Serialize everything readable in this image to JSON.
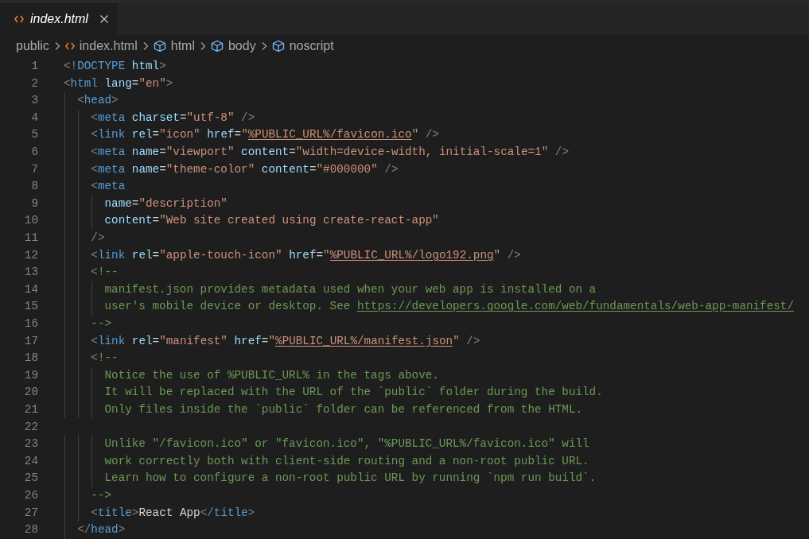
{
  "tabs": [
    {
      "label": "index.html",
      "selected": true
    }
  ],
  "breadcrumbs": [
    {
      "label": "public",
      "kind": "folder"
    },
    {
      "label": "index.html",
      "kind": "file"
    },
    {
      "label": "html",
      "kind": "element"
    },
    {
      "label": "body",
      "kind": "element"
    },
    {
      "label": "noscript",
      "kind": "element"
    }
  ],
  "lines": [
    {
      "number": "1",
      "tokens": [
        {
          "kind": "punct",
          "text": "<!"
        },
        {
          "kind": "tag",
          "text": "DOCTYPE"
        },
        {
          "kind": "attr",
          "text": " html"
        },
        {
          "kind": "punct",
          "text": ">"
        }
      ]
    },
    {
      "number": "2",
      "tokens": [
        {
          "kind": "punct",
          "text": "<"
        },
        {
          "kind": "tag",
          "text": "html"
        },
        {
          "kind": "attr",
          "text": " lang"
        },
        {
          "kind": "text",
          "text": "="
        },
        {
          "kind": "str",
          "text": "\"en\""
        },
        {
          "kind": "punct",
          "text": ">"
        }
      ]
    },
    {
      "number": "3",
      "tokens": [
        {
          "kind": "punct",
          "text": "  <"
        },
        {
          "kind": "tag",
          "text": "head"
        },
        {
          "kind": "punct",
          "text": ">"
        }
      ]
    },
    {
      "number": "4",
      "tokens": [
        {
          "kind": "punct",
          "text": "    <"
        },
        {
          "kind": "tag",
          "text": "meta"
        },
        {
          "kind": "attr",
          "text": " charset"
        },
        {
          "kind": "text",
          "text": "="
        },
        {
          "kind": "str",
          "text": "\"utf-8\""
        },
        {
          "kind": "punct",
          "text": " />"
        }
      ]
    },
    {
      "number": "5",
      "tokens": [
        {
          "kind": "punct",
          "text": "    <"
        },
        {
          "kind": "tag",
          "text": "link"
        },
        {
          "kind": "attr",
          "text": " rel"
        },
        {
          "kind": "text",
          "text": "="
        },
        {
          "kind": "str",
          "text": "\"icon\""
        },
        {
          "kind": "attr",
          "text": " href"
        },
        {
          "kind": "text",
          "text": "="
        },
        {
          "kind": "str",
          "text": "\""
        },
        {
          "kind": "strlink",
          "text": "%PUBLIC_URL%/favicon.ico"
        },
        {
          "kind": "str",
          "text": "\""
        },
        {
          "kind": "punct",
          "text": " />"
        }
      ]
    },
    {
      "number": "6",
      "tokens": [
        {
          "kind": "punct",
          "text": "    <"
        },
        {
          "kind": "tag",
          "text": "meta"
        },
        {
          "kind": "attr",
          "text": " name"
        },
        {
          "kind": "text",
          "text": "="
        },
        {
          "kind": "str",
          "text": "\"viewport\""
        },
        {
          "kind": "attr",
          "text": " content"
        },
        {
          "kind": "text",
          "text": "="
        },
        {
          "kind": "str",
          "text": "\"width=device-width, initial-scale=1\""
        },
        {
          "kind": "punct",
          "text": " />"
        }
      ]
    },
    {
      "number": "7",
      "tokens": [
        {
          "kind": "punct",
          "text": "    <"
        },
        {
          "kind": "tag",
          "text": "meta"
        },
        {
          "kind": "attr",
          "text": " name"
        },
        {
          "kind": "text",
          "text": "="
        },
        {
          "kind": "str",
          "text": "\"theme-color\""
        },
        {
          "kind": "attr",
          "text": " content"
        },
        {
          "kind": "text",
          "text": "="
        },
        {
          "kind": "str",
          "text": "\"#000000\""
        },
        {
          "kind": "punct",
          "text": " />"
        }
      ]
    },
    {
      "number": "8",
      "tokens": [
        {
          "kind": "punct",
          "text": "    <"
        },
        {
          "kind": "tag",
          "text": "meta"
        }
      ]
    },
    {
      "number": "9",
      "tokens": [
        {
          "kind": "attr",
          "text": "      name"
        },
        {
          "kind": "text",
          "text": "="
        },
        {
          "kind": "str",
          "text": "\"description\""
        }
      ]
    },
    {
      "number": "10",
      "tokens": [
        {
          "kind": "attr",
          "text": "      content"
        },
        {
          "kind": "text",
          "text": "="
        },
        {
          "kind": "str",
          "text": "\"Web site created using create-react-app\""
        }
      ]
    },
    {
      "number": "11",
      "tokens": [
        {
          "kind": "punct",
          "text": "    />"
        }
      ]
    },
    {
      "number": "12",
      "tokens": [
        {
          "kind": "punct",
          "text": "    <"
        },
        {
          "kind": "tag",
          "text": "link"
        },
        {
          "kind": "attr",
          "text": " rel"
        },
        {
          "kind": "text",
          "text": "="
        },
        {
          "kind": "str",
          "text": "\"apple-touch-icon\""
        },
        {
          "kind": "attr",
          "text": " href"
        },
        {
          "kind": "text",
          "text": "="
        },
        {
          "kind": "str",
          "text": "\""
        },
        {
          "kind": "strlink",
          "text": "%PUBLIC_URL%/logo192.png"
        },
        {
          "kind": "str",
          "text": "\""
        },
        {
          "kind": "punct",
          "text": " />"
        }
      ]
    },
    {
      "number": "13",
      "tokens": [
        {
          "kind": "comment",
          "text": "    <!--"
        }
      ]
    },
    {
      "number": "14",
      "tokens": [
        {
          "kind": "comment",
          "text": "      manifest.json provides metadata used when your web app is installed on a"
        }
      ]
    },
    {
      "number": "15",
      "tokens": [
        {
          "kind": "comment",
          "text": "      user's mobile device or desktop. See "
        },
        {
          "kind": "commentlink",
          "text": "https://developers.google.com/web/fundamentals/web-app-manifest/"
        }
      ]
    },
    {
      "number": "16",
      "tokens": [
        {
          "kind": "comment",
          "text": "    -->"
        }
      ]
    },
    {
      "number": "17",
      "tokens": [
        {
          "kind": "punct",
          "text": "    <"
        },
        {
          "kind": "tag",
          "text": "link"
        },
        {
          "kind": "attr",
          "text": " rel"
        },
        {
          "kind": "text",
          "text": "="
        },
        {
          "kind": "str",
          "text": "\"manifest\""
        },
        {
          "kind": "attr",
          "text": " href"
        },
        {
          "kind": "text",
          "text": "="
        },
        {
          "kind": "str",
          "text": "\""
        },
        {
          "kind": "strlink",
          "text": "%PUBLIC_URL%/manifest.json"
        },
        {
          "kind": "str",
          "text": "\""
        },
        {
          "kind": "punct",
          "text": " />"
        }
      ]
    },
    {
      "number": "18",
      "tokens": [
        {
          "kind": "comment",
          "text": "    <!--"
        }
      ]
    },
    {
      "number": "19",
      "tokens": [
        {
          "kind": "comment",
          "text": "      Notice the use of %PUBLIC_URL% in the tags above."
        }
      ]
    },
    {
      "number": "20",
      "tokens": [
        {
          "kind": "comment",
          "text": "      It will be replaced with the URL of the `public` folder during the build."
        }
      ]
    },
    {
      "number": "21",
      "tokens": [
        {
          "kind": "comment",
          "text": "      Only files inside the `public` folder can be referenced from the HTML."
        }
      ]
    },
    {
      "number": "22"
    },
    {
      "number": "23",
      "tokens": [
        {
          "kind": "comment",
          "text": "      Unlike \"/favicon.ico\" or \"favicon.ico\", \"%PUBLIC_URL%/favicon.ico\" will"
        }
      ]
    },
    {
      "number": "24",
      "tokens": [
        {
          "kind": "comment",
          "text": "      work correctly both with client-side routing and a non-root public URL."
        }
      ]
    },
    {
      "number": "25",
      "tokens": [
        {
          "kind": "comment",
          "text": "      Learn how to configure a non-root public URL by running `npm run build`."
        }
      ]
    },
    {
      "number": "26",
      "tokens": [
        {
          "kind": "comment",
          "text": "    -->"
        }
      ]
    },
    {
      "number": "27",
      "tokens": [
        {
          "kind": "punct",
          "text": "    <"
        },
        {
          "kind": "tag",
          "text": "title"
        },
        {
          "kind": "punct",
          "text": ">"
        },
        {
          "kind": "text",
          "text": "React App"
        },
        {
          "kind": "punct",
          "text": "</"
        },
        {
          "kind": "tag",
          "text": "title"
        },
        {
          "kind": "punct",
          "text": ">"
        }
      ]
    },
    {
      "number": "28",
      "tokens": [
        {
          "kind": "punct",
          "text": "  </"
        },
        {
          "kind": "tag",
          "text": "head"
        },
        {
          "kind": "punct",
          "text": ">"
        }
      ]
    }
  ]
}
